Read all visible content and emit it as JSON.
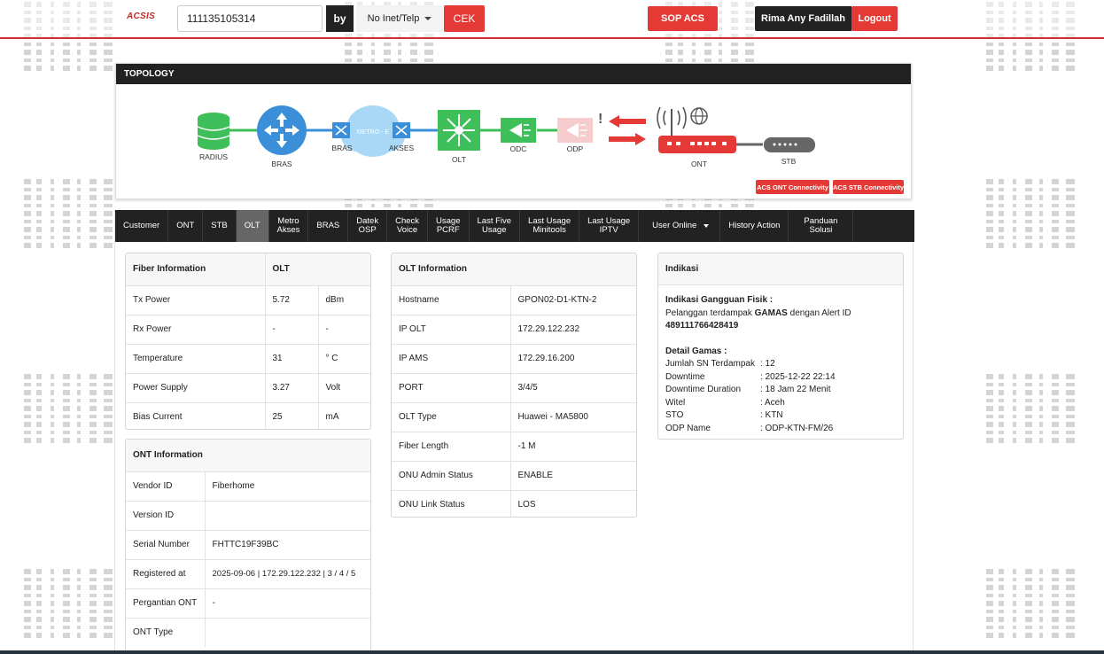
{
  "header": {
    "logo": "ACSIS",
    "search_value": "111135105314",
    "by_label": "by",
    "select_value": "No Inet/Telp",
    "cek_label": "CEK",
    "sop_label": "SOP ACS",
    "user_name": "Rima Any Fadillah",
    "logout_label": "Logout"
  },
  "topology": {
    "title": "TOPOLOGY",
    "nodes": {
      "radius": "RADIUS",
      "bras": "BRAS",
      "bras2": "BRAS",
      "metro": "METRO - E",
      "akses": "AKSES",
      "olt": "OLT",
      "odc": "ODC",
      "odp": "ODP",
      "ont": "ONT",
      "stb": "STB"
    },
    "acs_ont": "ACS ONT Connectivity",
    "acs_stb": "ACS STB Connectivity",
    "colors": {
      "green": "#3fbf5a",
      "blue": "#3a8fd8",
      "red": "#e53935",
      "gray": "#666666"
    }
  },
  "tabs": [
    {
      "label": "Customer"
    },
    {
      "label": "ONT"
    },
    {
      "label": "STB"
    },
    {
      "label": "OLT"
    },
    {
      "label": "Metro\nAkses"
    },
    {
      "label": "BRAS"
    },
    {
      "label": "Datek\nOSP"
    },
    {
      "label": "Check\nVoice"
    },
    {
      "label": "Usage\nPCRF"
    },
    {
      "label": "Last Five\nUsage"
    },
    {
      "label": "Last Usage\nMinitools"
    },
    {
      "label": "Last Usage\nIPTV"
    },
    {
      "label": "User Online"
    },
    {
      "label": "History Action"
    },
    {
      "label": "Panduan\nSolusi"
    }
  ],
  "fiber": {
    "header1": "Fiber Information",
    "header2": "OLT",
    "rows": [
      {
        "label": "Tx Power",
        "value": "5.72",
        "unit": "dBm"
      },
      {
        "label": "Rx Power",
        "value": "-",
        "unit": "-"
      },
      {
        "label": "Temperature",
        "value": "31",
        "unit": "° C"
      },
      {
        "label": "Power Supply",
        "value": "3.27",
        "unit": "Volt"
      },
      {
        "label": "Bias Current",
        "value": "25",
        "unit": "mA"
      }
    ]
  },
  "ont_info": {
    "header": "ONT Information",
    "rows": [
      {
        "label": "Vendor ID",
        "value": "Fiberhome"
      },
      {
        "label": "Version ID",
        "value": ""
      },
      {
        "label": "Serial Number",
        "value": "FHTTC19F39BC"
      },
      {
        "label": "Registered at",
        "value": "2025-09-06 | 172.29.122.232 | 3 / 4 / 5"
      },
      {
        "label": "Pergantian ONT",
        "value": "-"
      },
      {
        "label": "ONT Type",
        "value": ""
      }
    ]
  },
  "olt_info": {
    "header": "OLT Information",
    "rows": [
      {
        "label": "Hostname",
        "value": "GPON02-D1-KTN-2"
      },
      {
        "label": "IP OLT",
        "value": "172.29.122.232"
      },
      {
        "label": "IP AMS",
        "value": "172.29.16.200"
      },
      {
        "label": "PORT",
        "value": "3/4/5"
      },
      {
        "label": "OLT Type",
        "value": "Huawei - MA5800"
      },
      {
        "label": "Fiber Length",
        "value": "-1 M"
      },
      {
        "label": "ONU Admin Status",
        "value": "ENABLE"
      },
      {
        "label": "ONU Link Status",
        "value": "LOS"
      }
    ]
  },
  "indikasi": {
    "header": "Indikasi",
    "gangguan_title": "Indikasi Gangguan Fisik :",
    "gangguan_pre": "Pelanggan terdampak ",
    "gangguan_bold": "GAMAS",
    "gangguan_post": " dengan Alert ID",
    "alert_id": "489111766428419",
    "detail_title": "Detail Gamas :",
    "details": [
      {
        "k": "Jumlah SN Terdampak",
        "v": ": 12"
      },
      {
        "k": "Downtime",
        "v": ": 2025-12-22 22:14"
      },
      {
        "k": "Downtime Duration",
        "v": ": 18 Jam 22 Menit"
      },
      {
        "k": "Witel",
        "v": ": Aceh"
      },
      {
        "k": "STO",
        "v": ": KTN"
      },
      {
        "k": "ODP Name",
        "v": ": ODP-KTN-FM/26"
      }
    ]
  }
}
